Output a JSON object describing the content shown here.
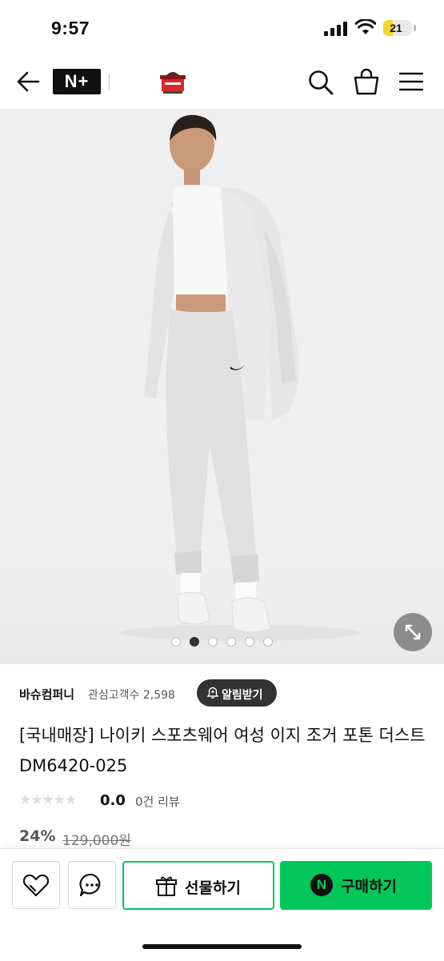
{
  "status_bar": {
    "time": "9:57",
    "battery": "21",
    "battery_level_percent": 21
  },
  "nav": {
    "brand_badge": "N+",
    "icons": [
      "back-arrow-icon",
      "store-logo",
      "search-icon",
      "shopping-bag-icon",
      "menu-icon"
    ]
  },
  "gallery": {
    "image_count": 6,
    "active_index": 1,
    "expand_icon": "expand-icon"
  },
  "seller": {
    "name": "바슈컴퍼니",
    "followers_label": "관심고객수 2,598",
    "follow_button": "알림받기"
  },
  "product": {
    "title": "[국내매장] 나이키 스포츠웨어 여성 이지 조거 포톤 더스트 DM6420-025",
    "stars": "★★★★★",
    "rating": "0.0",
    "review_count": "0건 리뷰",
    "discount": "24%",
    "original_price": "129,000원"
  },
  "bottom_bar": {
    "gift_label": "선물하기",
    "buy_label": "구매하기",
    "buy_badge": "N"
  },
  "colors": {
    "accent_green": "#03c75a",
    "dark": "#333333"
  }
}
